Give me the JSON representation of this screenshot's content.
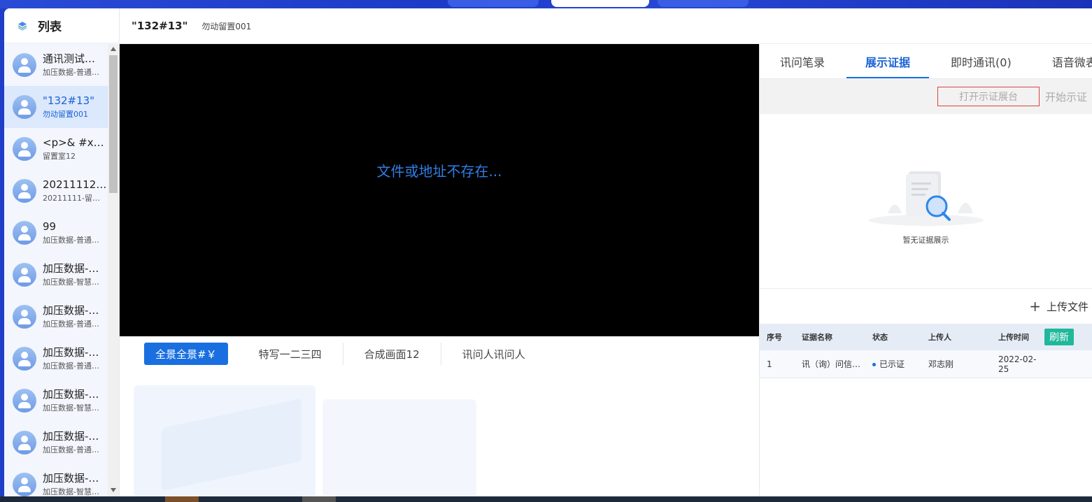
{
  "sidebar": {
    "title": "列表",
    "items": [
      {
        "title": "通讯测试…",
        "sub": "加压数据-普通…"
      },
      {
        "title": "\"132#13\"",
        "sub": "勿动留置001"
      },
      {
        "title": "<p>& #x1…",
        "sub": "留置室12"
      },
      {
        "title": "20211112-…",
        "sub": "20211111-留置…"
      },
      {
        "title": "99",
        "sub": "加压数据-普通…"
      },
      {
        "title": "加压数据-…",
        "sub": "加压数据-智慧…"
      },
      {
        "title": "加压数据-…",
        "sub": "加压数据-普通…"
      },
      {
        "title": "加压数据-…",
        "sub": "加压数据-普通…"
      },
      {
        "title": "加压数据-…",
        "sub": "加压数据-智慧…"
      },
      {
        "title": "加压数据-…",
        "sub": "加压数据-普通…"
      },
      {
        "title": "加压数据-…",
        "sub": "加压数据-智慧…"
      }
    ]
  },
  "header": {
    "title": "\"132#13\"",
    "subtitle": "勿动留置001"
  },
  "video": {
    "message": "文件或地址不存在..."
  },
  "camera_tabs": [
    "全景全景#￥",
    "特写一二三四",
    "合成画面12",
    "讯问人讯问人"
  ],
  "right_panel": {
    "tabs": [
      "讯问笔录",
      "展示证据",
      "即时通讯(0)",
      "语音微表情"
    ],
    "open_button": "打开示证展台",
    "start_button": "开始示证",
    "empty_text": "暂无证据展示",
    "upload_label": "上传文件",
    "table": {
      "headers": [
        "序号",
        "证据名称",
        "状态",
        "上传人",
        "上传时间"
      ],
      "refresh_label": "刷新",
      "rows": [
        {
          "no": "1",
          "name": "讯（询）问信…",
          "status": "已示证",
          "uploader": "邓志刚",
          "time": "2022-02-25"
        }
      ]
    }
  },
  "colors": {
    "accent": "#1a6fe0",
    "refresh": "#1fb89a",
    "topbar": "#1f3fc8"
  }
}
